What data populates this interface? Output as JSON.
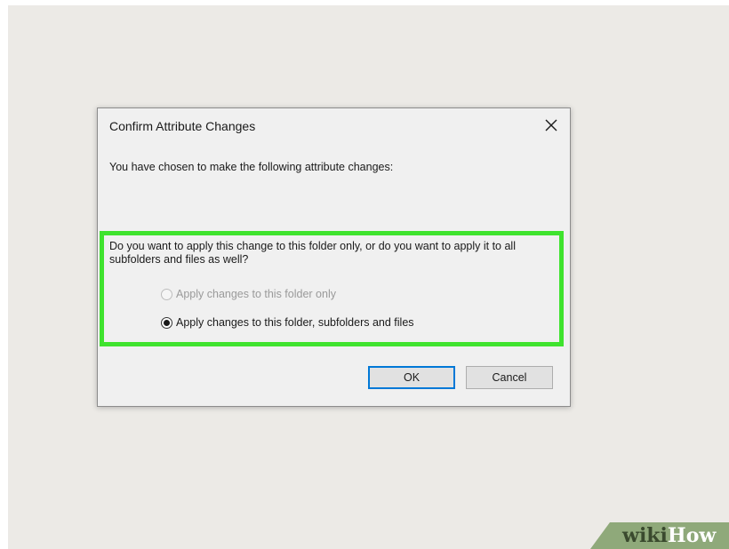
{
  "dialog": {
    "title": "Confirm Attribute Changes",
    "intro": "You have chosen to make the following attribute changes:",
    "question": "Do you want to apply this change to this folder only, or do you want to apply it to all subfolders and files as well?",
    "options": [
      {
        "label": "Apply changes to this folder only",
        "selected": false,
        "enabled": false
      },
      {
        "label": "Apply changes to this folder, subfolders and files",
        "selected": true,
        "enabled": true
      }
    ],
    "ok_label": "OK",
    "cancel_label": "Cancel"
  },
  "icons": {
    "close": "close-icon"
  },
  "colors": {
    "highlight": "#3fe32e",
    "ok_border": "#0078d7",
    "background": "#eceae6"
  },
  "watermark": {
    "part1": "wiki",
    "part2": "How"
  }
}
